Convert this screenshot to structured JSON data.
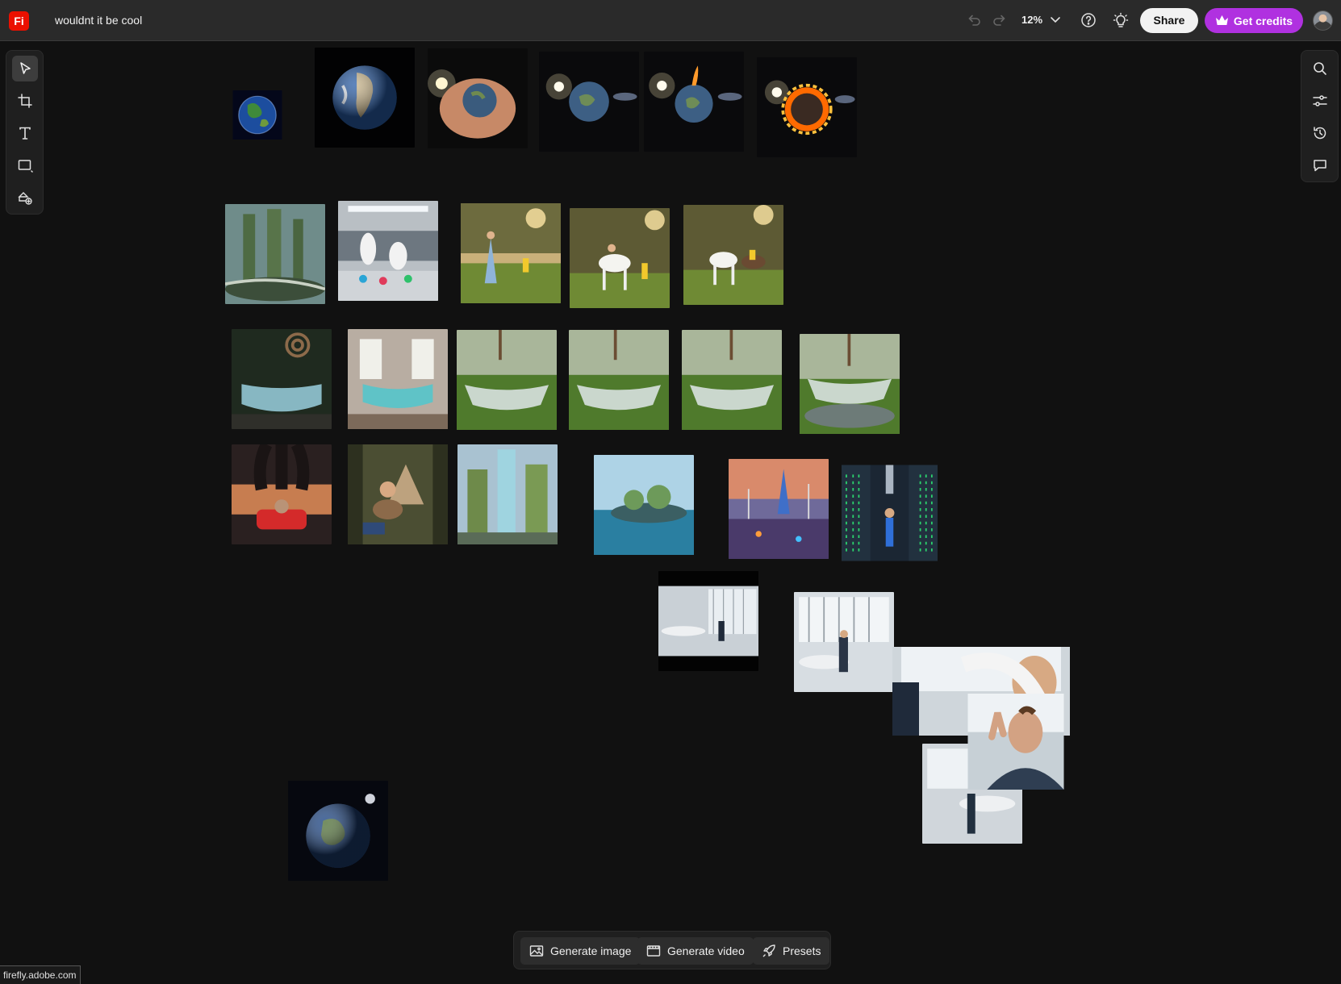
{
  "app": {
    "logo_text": "Fi",
    "document_title": "wouldnt it be cool"
  },
  "header": {
    "zoom_level": "12%",
    "share_label": "Share",
    "credits_label": "Get credits"
  },
  "left_toolbar": [
    "select-tool",
    "artboard-tool",
    "text-tool",
    "shape-tool",
    "generative-fill-tool"
  ],
  "right_toolbar": [
    "search",
    "adjustments",
    "history",
    "comments"
  ],
  "bottom_bar": {
    "generate_image": "Generate image",
    "generate_video": "Generate video",
    "presets": "Presets"
  },
  "status_bar": {
    "url": "firefly.adobe.com"
  },
  "colors": {
    "accent": "#b031e0",
    "logo": "#eb1000",
    "canvas": "#111111"
  }
}
